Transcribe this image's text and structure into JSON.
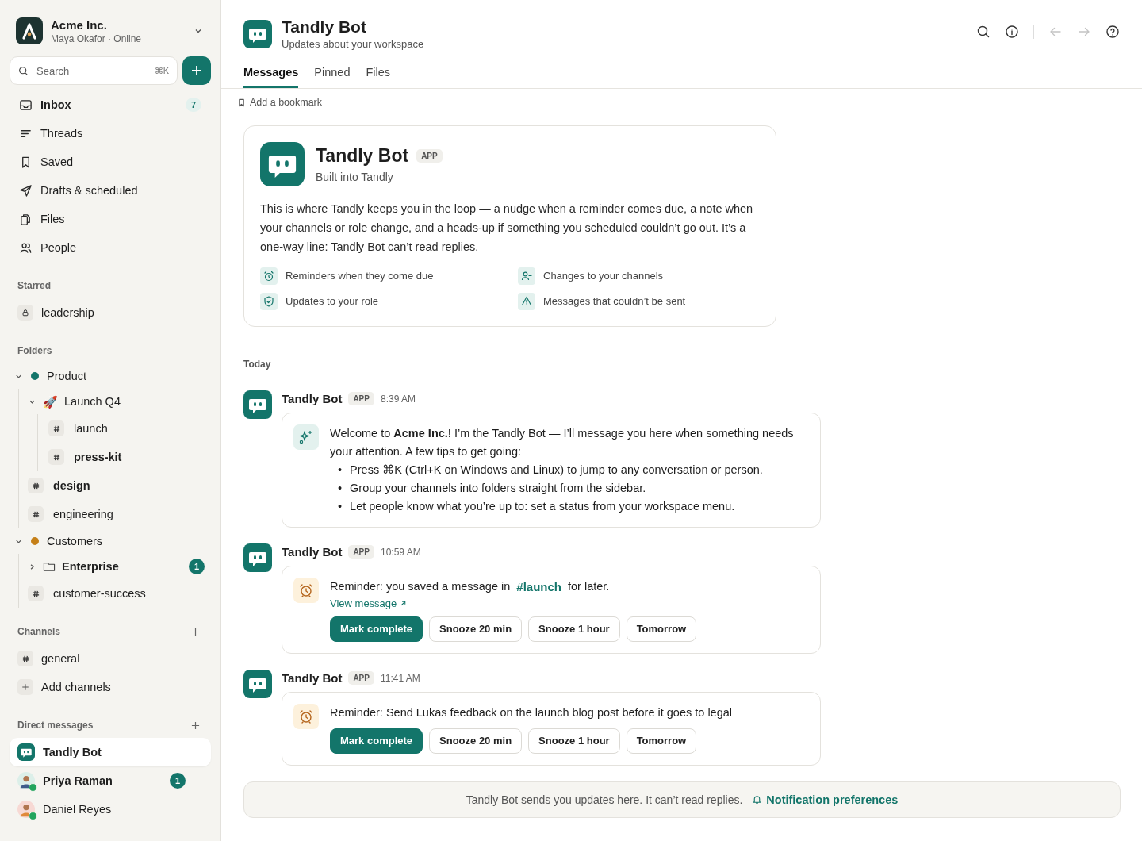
{
  "workspace": {
    "name": "Acme Inc.",
    "status": "Maya Okafor · Online"
  },
  "search": {
    "placeholder": "Search",
    "shortcut": "⌘K"
  },
  "nav": [
    {
      "label": "Inbox",
      "unread": true,
      "badge": "7"
    },
    {
      "label": "Threads",
      "unread": false
    },
    {
      "label": "Saved",
      "unread": false
    },
    {
      "label": "Drafts & scheduled",
      "unread": false
    },
    {
      "label": "Files",
      "unread": false
    },
    {
      "label": "People",
      "unread": false
    }
  ],
  "starred": {
    "heading": "Starred",
    "items": [
      {
        "label": "leadership",
        "unread": false
      }
    ]
  },
  "folders": {
    "heading": "Folders",
    "items": [
      {
        "kind": "group",
        "label": "Product",
        "color": "#13756a",
        "expanded": true,
        "children": [
          {
            "kind": "subfolder",
            "label": "Launch Q4",
            "emoji": "🚀",
            "expanded": true,
            "unread": false,
            "children": [
              {
                "kind": "channel",
                "label": "launch",
                "unread": false
              },
              {
                "kind": "channel",
                "label": "press-kit",
                "unread": true
              }
            ]
          },
          {
            "kind": "channel",
            "label": "design",
            "unread": true
          },
          {
            "kind": "channel",
            "label": "engineering",
            "unread": false
          }
        ]
      },
      {
        "kind": "group",
        "label": "Customers",
        "color": "#c57f17",
        "expanded": true,
        "children": [
          {
            "kind": "subfolder",
            "label": "Enterprise",
            "expanded": false,
            "unread": true,
            "badge": "1"
          },
          {
            "kind": "channel",
            "label": "customer-success",
            "unread": false
          }
        ]
      }
    ]
  },
  "channels": {
    "heading": "Channels",
    "items": [
      {
        "kind": "channel",
        "label": "general",
        "unread": false
      },
      {
        "kind": "add",
        "label": "Add channels",
        "unread": false
      }
    ]
  },
  "direct_messages": {
    "heading": "Direct messages",
    "items": [
      {
        "kind": "bot",
        "label": "Tandly Bot",
        "selected": true,
        "unread": true
      },
      {
        "kind": "person",
        "label": "Priya Raman",
        "selected": false,
        "unread": true,
        "badge": "1",
        "online": true
      },
      {
        "kind": "person",
        "label": "Daniel Reyes",
        "selected": false,
        "unread": false,
        "online": true
      }
    ]
  },
  "header": {
    "title": "Tandly Bot",
    "subtitle": "Updates about your workspace",
    "toolbar": [
      {
        "disabled": false
      },
      {
        "disabled": false
      },
      {
        "disabled": true
      },
      {
        "disabled": true
      },
      {
        "disabled": false
      }
    ]
  },
  "tabs": [
    {
      "label": "Messages",
      "selected": true
    },
    {
      "label": "Pinned",
      "selected": false
    },
    {
      "label": "Files",
      "selected": false
    }
  ],
  "bookmark": {
    "label": "Add a bookmark"
  },
  "intro": {
    "title": "Tandly Bot",
    "badge": "APP",
    "subtitle": "Built into Tandly",
    "description": "This is where Tandly keeps you in the loop — a nudge when a reminder comes due, a note when your channels or role change, and a heads-up if something you scheduled couldn’t go out. It’s a one-way line: Tandly Bot can’t read replies.",
    "features": [
      "Reminders when they come due",
      "Changes to your channels",
      "Updates to your role",
      "Messages that couldn’t be sent"
    ]
  },
  "day_label": "Today",
  "messages": [
    {
      "kind": "welcome",
      "sender": "Tandly Bot",
      "badge": "APP",
      "time": "8:39 AM",
      "text": "Welcome to **Acme Inc.**! I’m the Tandly Bot — I’ll message you here when something needs your attention. A few tips to get going:",
      "bullet": "•",
      "tips": [
        "Press ⌘K (Ctrl+K on Windows and Linux) to jump to any conversation or person.",
        "Group your channels into folders straight from the sidebar.",
        "Let people know what you’re up to: set a status from your workspace menu."
      ]
    },
    {
      "kind": "reminder",
      "sender": "Tandly Bot",
      "badge": "APP",
      "time": "10:59 AM",
      "text": "Reminder: you saved a message in",
      "channel": "#launch",
      "text_after": "for later.",
      "link": "View message",
      "actions": [
        {
          "label": "Mark complete",
          "primary": true
        },
        {
          "label": "Snooze 20 min",
          "primary": false
        },
        {
          "label": "Snooze 1 hour",
          "primary": false
        },
        {
          "label": "Tomorrow",
          "primary": false
        }
      ]
    },
    {
      "kind": "reminder",
      "sender": "Tandly Bot",
      "badge": "APP",
      "time": "11:41 AM",
      "text": "Reminder: Send Lukas feedback on the launch blog post before it goes to legal",
      "actions": [
        {
          "label": "Mark complete",
          "primary": true
        },
        {
          "label": "Snooze 20 min",
          "primary": false
        },
        {
          "label": "Snooze 1 hour",
          "primary": false
        },
        {
          "label": "Tomorrow",
          "primary": false
        }
      ]
    }
  ],
  "footer": {
    "note": "Tandly Bot sends you updates here. It can’t read replies.",
    "link": "Notification preferences"
  }
}
